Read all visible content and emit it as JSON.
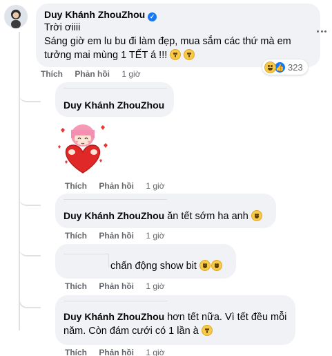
{
  "main_comment": {
    "author": "Duy Khánh ZhouZhou",
    "line1": "Trời ơiiii",
    "line2": "Sáng giờ em lu bu đi làm đẹp, mua sắm các thứ mà em",
    "line3": "tưởng mai mùng 1 TẾT á !!!",
    "like_label": "Thích",
    "reply_label": "Phản hồi",
    "time": "1 giờ",
    "reaction_count": "323"
  },
  "replies": [
    {
      "author": "Duy Khánh ZhouZhou",
      "sticker": "heart-girl-sticker",
      "like_label": "Thích",
      "reply_label": "Phản hồi",
      "time": "1 giờ"
    },
    {
      "author": "Duy Khánh ZhouZhou",
      "text": "ăn tết sớm ha anh",
      "like_label": "Thích",
      "reply_label": "Phản hồi",
      "time": "1 giờ"
    },
    {
      "text": "chấn động show bit",
      "like_label": "Thích",
      "reply_label": "Phản hồi",
      "time": "1 giờ"
    },
    {
      "author": "Duy Khánh ZhouZhou",
      "text_line1": "hơn tết nữa. Vì tết đều mỗi",
      "text_line2": "năm. Còn đám cưới có 1 lần à",
      "like_label": "Thích",
      "reply_label": "Phản hồi",
      "time": "1 giờ"
    }
  ],
  "colors": {
    "bubble": "#f0f2f5",
    "secondary_text": "#65676b",
    "verified": "#1877f2",
    "reaction_like": "#1877f2"
  }
}
